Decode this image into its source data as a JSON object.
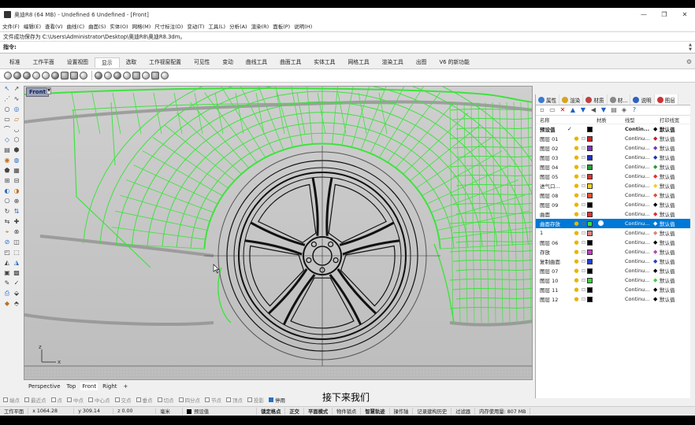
{
  "window": {
    "title": "奥迪R8 (64 MB) - Undefined 6 Undefined - [Front]",
    "controls": [
      "—",
      "❐",
      "✕"
    ]
  },
  "menu": [
    "文件(F)",
    "编辑(E)",
    "查看(V)",
    "曲线(C)",
    "曲面(S)",
    "实体(O)",
    "网格(M)",
    "尺寸标注(D)",
    "变动(T)",
    "工具(L)",
    "分析(A)",
    "渲染(R)",
    "面板(P)",
    "说明(H)"
  ],
  "command": {
    "history": "文件成功保存为 C:\\Users\\Administrator\\Desktop\\奥迪R8\\奥迪R8.3dm。",
    "prompt": "指令:"
  },
  "ribbon_tabs": [
    "标准",
    "工作平面",
    "设置视图",
    "显示",
    "选取",
    "工作视窗配置",
    "可见性",
    "变动",
    "曲线工具",
    "曲面工具",
    "实体工具",
    "网格工具",
    "渲染工具",
    "出图",
    "V6 的新功能"
  ],
  "active_ribbon_tab": "显示",
  "viewport": {
    "name": "Front",
    "menu_arrow": "▼",
    "tabs": [
      "Perspective",
      "Top",
      "Front",
      "Right"
    ],
    "active_tab": "Front",
    "add_tab": "+",
    "axis_label_z": "z",
    "axis_label_x": "x"
  },
  "osnaps": [
    {
      "label": "端点",
      "checked": false
    },
    {
      "label": "最近点",
      "checked": false
    },
    {
      "label": "点",
      "checked": false
    },
    {
      "label": "中点",
      "checked": false
    },
    {
      "label": "中心点",
      "checked": false
    },
    {
      "label": "交点",
      "checked": false
    },
    {
      "label": "垂点",
      "checked": false
    },
    {
      "label": "切点",
      "checked": false
    },
    {
      "label": "四分点",
      "checked": false
    },
    {
      "label": "节点",
      "checked": false
    },
    {
      "label": "顶点",
      "checked": false
    },
    {
      "label": "投影",
      "checked": false
    },
    {
      "label": "停用",
      "checked": true
    }
  ],
  "subtitle": "接下来我们",
  "status": {
    "cplane": "工作平面",
    "x": "x 1064.28",
    "y": "y 309.14",
    "z": "z 0.00",
    "units": "毫米",
    "layer": "预设值",
    "items": [
      "锁定格点",
      "正交",
      "平面模式",
      "物件锁点",
      "智慧轨迹",
      "操作轴",
      "记录建构历史",
      "过滤器"
    ],
    "bold_items": [
      "锁定格点",
      "正交",
      "平面模式",
      "智慧轨迹"
    ],
    "memory": "内存使用量: 807 MB"
  },
  "panel": {
    "tabs": [
      {
        "label": "属性",
        "color": "#3a7bd5"
      },
      {
        "label": "渲染",
        "color": "#d9a320"
      },
      {
        "label": "材质",
        "color": "#c04040"
      },
      {
        "label": "材...",
        "color": "#888888"
      },
      {
        "label": "说明",
        "color": "#3060c0"
      },
      {
        "label": "图层",
        "color": "#cc3333"
      }
    ],
    "active_tab": "图层",
    "headers": {
      "name": "名称",
      "material": "材质",
      "linetype": "线型",
      "printwidth": "打印线宽"
    },
    "layers": [
      {
        "name": "预设值",
        "current": true,
        "color": "#000000",
        "linetype": "Contin...",
        "pw": "默认值",
        "pcolor": "#000000",
        "bold": true
      },
      {
        "name": "图层 01",
        "color": "#d02020",
        "linetype": "Continu...",
        "pw": "默认值",
        "pcolor": "#c02020"
      },
      {
        "name": "图层 02",
        "color": "#8030c0",
        "linetype": "Continu...",
        "pw": "默认值",
        "pcolor": "#8030c0"
      },
      {
        "name": "图层 03",
        "color": "#2030c0",
        "linetype": "Continu...",
        "pw": "默认值",
        "pcolor": "#2030c0"
      },
      {
        "name": "图层 04",
        "color": "#20a030",
        "linetype": "Continu...",
        "pw": "默认值",
        "pcolor": "#20a030"
      },
      {
        "name": "图层 05",
        "color": "#e03030",
        "linetype": "Continu...",
        "pw": "默认值",
        "pcolor": "#e03030"
      },
      {
        "name": "进气口...",
        "color": "#f0d020",
        "linetype": "Continu...",
        "pw": "默认值",
        "pcolor": "#f0d020"
      },
      {
        "name": "图层 08",
        "color": "#e05030",
        "linetype": "Continu...",
        "pw": "默认值",
        "pcolor": "#e05030"
      },
      {
        "name": "图层 09",
        "color": "#000000",
        "linetype": "Continu...",
        "pw": "默认值",
        "pcolor": "#000000"
      },
      {
        "name": "曲面",
        "color": "#e03030",
        "linetype": "Continu...",
        "pw": "默认值",
        "pcolor": "#e03030"
      },
      {
        "name": "曲面存放",
        "color": "#40e040",
        "linetype": "Continu...",
        "pw": "默认值",
        "pcolor": "#40e040",
        "selected": true
      },
      {
        "name": "1",
        "color": "#e08080",
        "linetype": "Continu...",
        "pw": "默认值",
        "pcolor": "#e08080"
      },
      {
        "name": "图层 06",
        "color": "#000000",
        "linetype": "Continu...",
        "pw": "默认值",
        "pcolor": "#000000"
      },
      {
        "name": "存放",
        "color": "#c040c0",
        "linetype": "Continu...",
        "pw": "默认值",
        "pcolor": "#c040c0"
      },
      {
        "name": "复制曲面",
        "color": "#2040d0",
        "linetype": "Continu...",
        "pw": "默认值",
        "pcolor": "#2040d0"
      },
      {
        "name": "图层 07",
        "color": "#000000",
        "linetype": "Continu...",
        "pw": "默认值",
        "pcolor": "#000000"
      },
      {
        "name": "图层 10",
        "color": "#40d040",
        "linetype": "Continu...",
        "pw": "默认值",
        "pcolor": "#40d040"
      },
      {
        "name": "图层 11",
        "color": "#000000",
        "linetype": "Continu...",
        "pw": "默认值",
        "pcolor": "#000000"
      },
      {
        "name": "图层 12",
        "color": "#000000",
        "linetype": "Continu...",
        "pw": "默认值",
        "pcolor": "#000000"
      }
    ]
  },
  "colors": {
    "wire_green": "#3fe23f",
    "selection_blue": "#0078d7",
    "viewport_bg": "#c8c8c8"
  }
}
